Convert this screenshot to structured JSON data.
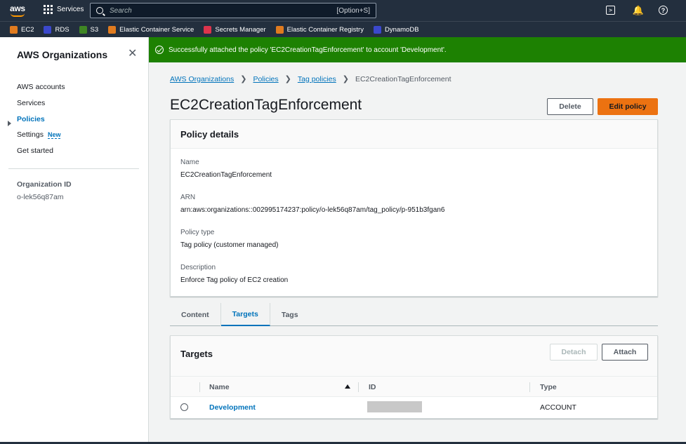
{
  "topnav": {
    "logo_text": "aws",
    "services_label": "Services",
    "search_placeholder": "Search",
    "search_shortcut": "[Option+S]",
    "icons": [
      "grid-icon",
      "search-icon",
      "cloudshell-icon",
      "bell-icon",
      "help-icon"
    ]
  },
  "favorites": [
    {
      "label": "EC2",
      "color": "#e07b1f"
    },
    {
      "label": "RDS",
      "color": "#3b48cc"
    },
    {
      "label": "S3",
      "color": "#3f8624"
    },
    {
      "label": "Elastic Container Service",
      "color": "#e07b1f"
    },
    {
      "label": "Secrets Manager",
      "color": "#dd344c"
    },
    {
      "label": "Elastic Container Registry",
      "color": "#e07b1f"
    },
    {
      "label": "DynamoDB",
      "color": "#3b48cc"
    }
  ],
  "sidebar": {
    "title": "AWS Organizations",
    "items": [
      {
        "label": "AWS accounts"
      },
      {
        "label": "Services"
      },
      {
        "label": "Policies"
      },
      {
        "label": "Settings",
        "badge": "New"
      },
      {
        "label": "Get started"
      }
    ],
    "org_id_label": "Organization ID",
    "org_id_value": "o-lek56q87am"
  },
  "flash": {
    "message": "Successfully attached the policy 'EC2CreationTagEnforcement' to account 'Development'."
  },
  "breadcrumb": [
    "AWS Organizations",
    "Policies",
    "Tag policies",
    "EC2CreationTagEnforcement"
  ],
  "page": {
    "title": "EC2CreationTagEnforcement",
    "delete_label": "Delete",
    "edit_label": "Edit policy"
  },
  "details": {
    "heading": "Policy details",
    "fields": [
      {
        "label": "Name",
        "value": "EC2CreationTagEnforcement"
      },
      {
        "label": "ARN",
        "value": "arn:aws:organizations::002995174237:policy/o-lek56q87am/tag_policy/p-951b3fgan6"
      },
      {
        "label": "Policy type",
        "value": "Tag policy (customer managed)"
      },
      {
        "label": "Description",
        "value": "Enforce Tag policy of EC2 creation"
      }
    ]
  },
  "tabs": [
    "Content",
    "Targets",
    "Tags"
  ],
  "targets": {
    "heading": "Targets",
    "detach_label": "Detach",
    "attach_label": "Attach",
    "columns": [
      "Name",
      "ID",
      "Type"
    ],
    "rows": [
      {
        "name": "Development",
        "type": "ACCOUNT"
      }
    ]
  },
  "colors": {
    "nav_bg": "#232f3e",
    "success": "#1d8102",
    "link": "#0073bb",
    "primary_button": "#ec7211"
  }
}
